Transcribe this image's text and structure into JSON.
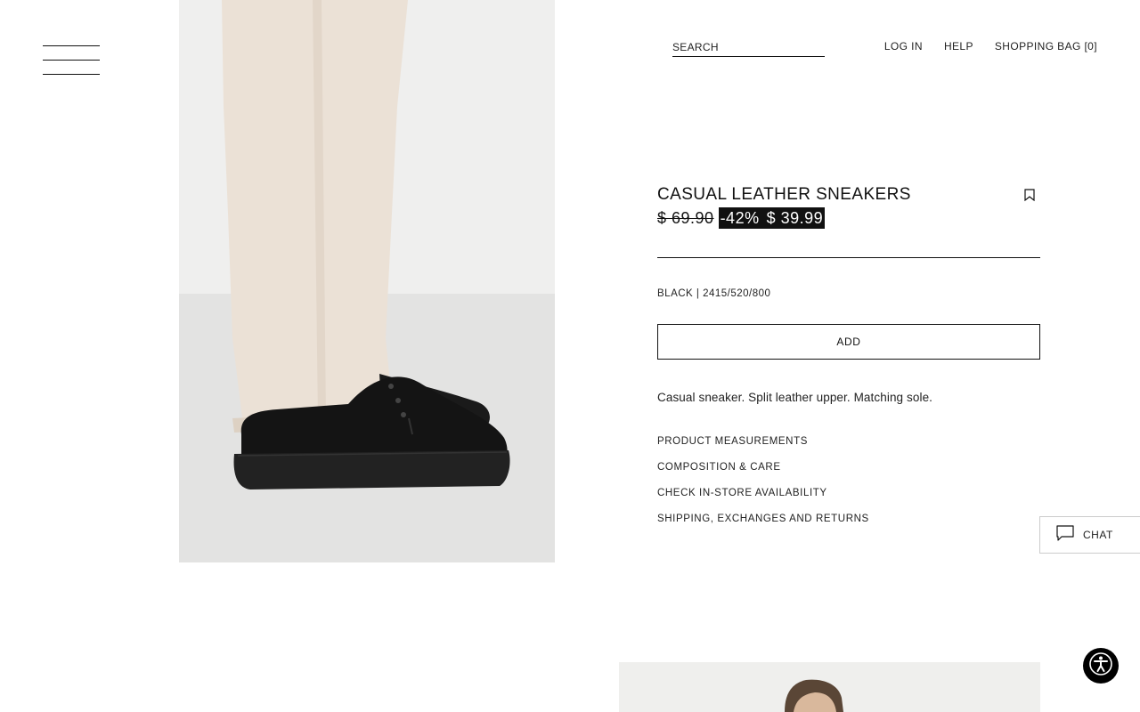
{
  "header": {
    "search_label": "SEARCH",
    "log_in": "LOG IN",
    "help": "HELP",
    "shopping_bag": "SHOPPING BAG [0]"
  },
  "product": {
    "title": "CASUAL LEATHER SNEAKERS",
    "old_price": "$ 69.90",
    "discount": "-42%",
    "price": "$ 39.99",
    "color_ref": "BLACK | 2415/520/800",
    "add_label": "ADD",
    "description": "Casual sneaker. Split leather upper. Matching sole.",
    "links": [
      "PRODUCT MEASUREMENTS",
      "COMPOSITION & CARE",
      "CHECK IN-STORE AVAILABILITY",
      "SHIPPING, EXCHANGES AND RETURNS"
    ]
  },
  "chat": {
    "label": "CHAT"
  },
  "colors": {
    "text": "#111111",
    "background": "#ffffff",
    "sale_background": "#111111",
    "sale_text": "#ffffff"
  },
  "icons": {
    "menu": "hamburger-icon",
    "bookmark": "bookmark-icon",
    "chat": "chat-bubble-icon",
    "accessibility": "accessibility-icon"
  }
}
